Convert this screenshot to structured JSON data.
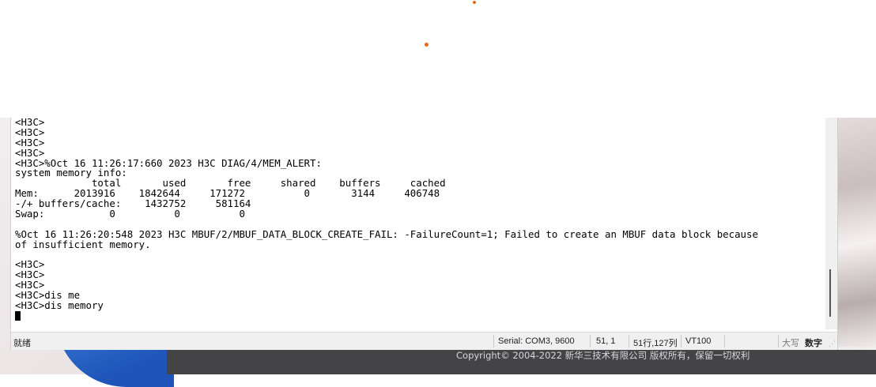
{
  "terminal": {
    "lines": [
      "<H3C>",
      "<H3C>",
      "<H3C>",
      "<H3C>",
      "<H3C>%Oct 16 11:26:17:660 2023 H3C DIAG/4/MEM_ALERT:",
      "system memory info:",
      "             total       used       free     shared    buffers     cached",
      "Mem:      2013916    1842644     171272          0       3144     406748",
      "-/+ buffers/cache:    1432752     581164",
      "Swap:           0          0          0",
      "",
      "%Oct 16 11:26:20:548 2023 H3C MBUF/2/MBUF_DATA_BLOCK_CREATE_FAIL: -FailureCount=1; Failed to create an MBUF data block because",
      "of insufficient memory.",
      "",
      "<H3C>",
      "<H3C>",
      "<H3C>",
      "<H3C>dis me",
      "<H3C>dis memory"
    ]
  },
  "statusbar": {
    "ready": "就绪",
    "serial": "Serial: COM3, 9600",
    "position": "51,  1",
    "rows_cols": "51行,127列",
    "emulation": "VT100",
    "caps": "大写",
    "num": "数字"
  },
  "footer": {
    "copyright": "Copyright© 2004-2022 新华三技术有限公司 版权所有，保留一切权利"
  }
}
